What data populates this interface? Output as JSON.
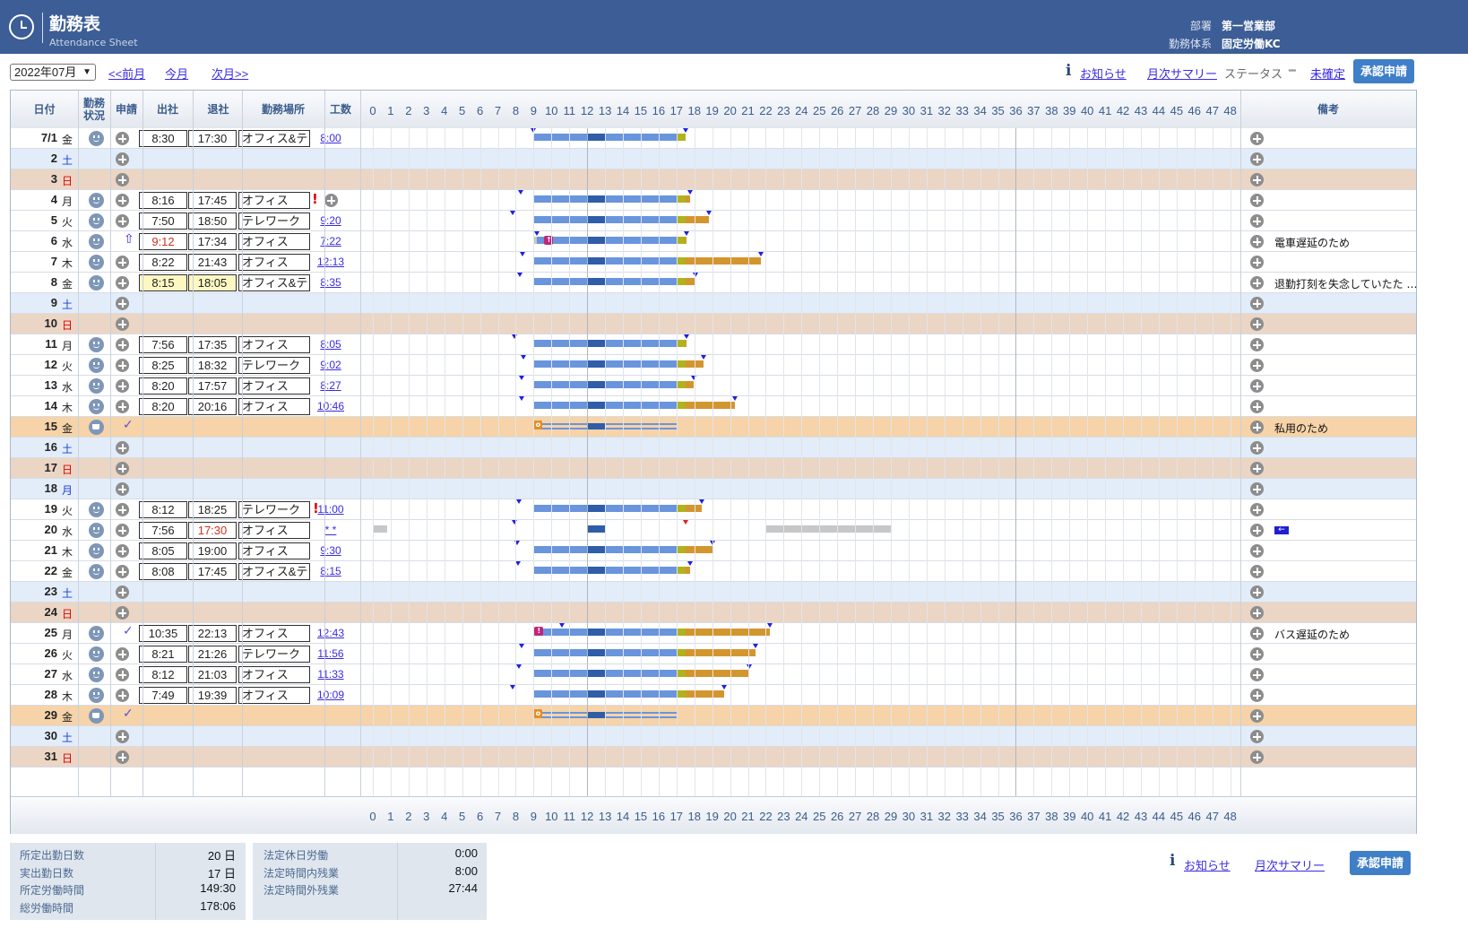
{
  "header": {
    "title": "勤務表",
    "subtitle": "Attendance Sheet",
    "dept_label": "部署",
    "dept_value": "第一営業部",
    "system_label": "勤務体系",
    "system_value": "固定労働KC"
  },
  "toolbar": {
    "month_select": "2022年07月",
    "prev_link": "<<前月",
    "this_link": "今月",
    "next_link": "次月>>",
    "notice": "お知らせ",
    "monthly_summary": "月次サマリー",
    "status_label": "ステータス",
    "status_dash": "━",
    "status_value": "未確定",
    "approve_button": "承認申請"
  },
  "columns": {
    "date": "日付",
    "status": "勤務状況",
    "request": "申請",
    "clock_in": "出社",
    "clock_out": "退社",
    "place": "勤務場所",
    "hours": "工数",
    "remarks": "備考"
  },
  "hours_axis": [
    "0",
    "1",
    "2",
    "3",
    "4",
    "5",
    "6",
    "7",
    "8",
    "9",
    "10",
    "11",
    "12",
    "13",
    "14",
    "15",
    "16",
    "17",
    "18",
    "19",
    "20",
    "21",
    "22",
    "23",
    "24",
    "25",
    "26",
    "27",
    "28",
    "29",
    "30",
    "31",
    "32",
    "33",
    "34",
    "35",
    "36",
    "37",
    "38",
    "39",
    "40",
    "41",
    "42",
    "43",
    "44",
    "45",
    "46",
    "47",
    "48"
  ],
  "rows": [
    {
      "day": "7/1",
      "dow": "金",
      "type": "wd",
      "face": "smile",
      "req": "plus",
      "in": "8:30",
      "out": "17:30",
      "place": "オフィス&テレ",
      "hours": "8:00",
      "note": "",
      "bars": [
        [
          9,
          0.5,
          12,
          "b1"
        ],
        [
          12,
          0,
          13,
          "b2"
        ],
        [
          13,
          0,
          17,
          "b1"
        ],
        [
          17,
          0,
          17,
          "b3"
        ]
      ],
      "tri": [
        9,
        17.5
      ]
    },
    {
      "day": "2",
      "dow": "土",
      "type": "sat",
      "face": "",
      "req": "plus"
    },
    {
      "day": "3",
      "dow": "日",
      "type": "sun",
      "face": "",
      "req": "plus"
    },
    {
      "day": "4",
      "dow": "月",
      "type": "wd",
      "face": "smile",
      "req": "plus",
      "in": "8:16",
      "out": "17:45",
      "place": "オフィス",
      "hours": "",
      "warn": true,
      "note": "",
      "tri": [
        8.27,
        17.75
      ]
    },
    {
      "day": "5",
      "dow": "火",
      "type": "wd",
      "face": "smile",
      "req": "plus",
      "in": "7:50",
      "out": "18:50",
      "place": "テレワーク",
      "hours": "9:20",
      "note": "",
      "tri": [
        7.83,
        18.83
      ]
    },
    {
      "day": "6",
      "dow": "水",
      "type": "wd",
      "face": "smile",
      "req": "up",
      "in": "9:12",
      "in_late": true,
      "out": "17:34",
      "place": "オフィス",
      "hours": "7:22",
      "note": "電車遅延のため",
      "tri": [
        9.2,
        17.57
      ]
    },
    {
      "day": "7",
      "dow": "木",
      "type": "wd",
      "face": "smile",
      "req": "plus",
      "in": "8:22",
      "out": "21:43",
      "place": "オフィス",
      "hours": "12:13",
      "note": "",
      "tri": [
        8.37,
        21.72
      ]
    },
    {
      "day": "8",
      "dow": "金",
      "type": "wd",
      "face": "smile",
      "req": "plus",
      "in": "8:15",
      "out": "18:05",
      "hl": true,
      "place": "オフィス&テレ",
      "hours": "8:35",
      "note": "退勤打刻を失念していたた …",
      "tri": [
        8.25,
        18.08
      ]
    },
    {
      "day": "9",
      "dow": "土",
      "type": "sat",
      "face": "",
      "req": "plus"
    },
    {
      "day": "10",
      "dow": "日",
      "type": "sun",
      "face": "",
      "req": "plus"
    },
    {
      "day": "11",
      "dow": "月",
      "type": "wd",
      "face": "smile",
      "req": "plus",
      "in": "7:56",
      "out": "17:35",
      "place": "オフィス",
      "hours": "8:05",
      "note": "",
      "tri": [
        7.93,
        17.58
      ]
    },
    {
      "day": "12",
      "dow": "火",
      "type": "wd",
      "face": "smile",
      "req": "plus",
      "in": "8:25",
      "out": "18:32",
      "place": "テレワーク",
      "hours": "9:02",
      "note": "",
      "tri": [
        8.42,
        18.53
      ]
    },
    {
      "day": "13",
      "dow": "水",
      "type": "wd",
      "face": "smile",
      "req": "plus",
      "in": "8:20",
      "out": "17:57",
      "place": "オフィス",
      "hours": "8:27",
      "note": "",
      "tri": [
        8.33,
        17.95
      ]
    },
    {
      "day": "14",
      "dow": "木",
      "type": "wd",
      "face": "smile",
      "req": "plus",
      "in": "8:20",
      "out": "20:16",
      "place": "オフィス",
      "hours": "10:46",
      "note": "",
      "tri": [
        8.33,
        20.27
      ]
    },
    {
      "day": "15",
      "dow": "金",
      "type": "leave",
      "face": "cup",
      "req": "check",
      "note": "私用のため",
      "leave": true
    },
    {
      "day": "16",
      "dow": "土",
      "type": "sat",
      "face": "",
      "req": "plus"
    },
    {
      "day": "17",
      "dow": "日",
      "type": "sun",
      "face": "",
      "req": "plus"
    },
    {
      "day": "18",
      "dow": "月",
      "type": "sat",
      "face": "",
      "req": "plus"
    },
    {
      "day": "19",
      "dow": "火",
      "type": "wd",
      "face": "smile",
      "req": "plus",
      "in": "8:12",
      "out": "18:25",
      "place": "テレワーク",
      "hours": "11:00",
      "warn": true,
      "note": "",
      "tri": [
        8.2,
        18.42
      ]
    },
    {
      "day": "20",
      "dow": "水",
      "type": "wd",
      "face": "smile",
      "req": "plus",
      "in": "7:56",
      "out": "17:30",
      "out_late": true,
      "place": "オフィス",
      "hours": "* *",
      "note": "",
      "arrow": true
    },
    {
      "day": "21",
      "dow": "木",
      "type": "wd",
      "face": "smile",
      "req": "plus",
      "in": "8:05",
      "out": "19:00",
      "place": "オフィス",
      "hours": "9:30",
      "note": "",
      "tri": [
        8.08,
        19.0
      ]
    },
    {
      "day": "22",
      "dow": "金",
      "type": "wd",
      "face": "smile",
      "req": "plus",
      "in": "8:08",
      "out": "17:45",
      "place": "オフィス&テレ",
      "hours": "8:15",
      "note": "",
      "tri": [
        8.13,
        17.75
      ]
    },
    {
      "day": "23",
      "dow": "土",
      "type": "sat",
      "face": "",
      "req": "plus"
    },
    {
      "day": "24",
      "dow": "日",
      "type": "sun",
      "face": "",
      "req": "plus"
    },
    {
      "day": "25",
      "dow": "月",
      "type": "wd",
      "face": "smile",
      "req": "check",
      "in": "10:35",
      "out": "22:13",
      "place": "オフィス",
      "hours": "12:43",
      "note": "バス遅延のため",
      "tri": [
        10.58,
        22.22
      ]
    },
    {
      "day": "26",
      "dow": "火",
      "type": "wd",
      "face": "smile",
      "req": "plus",
      "in": "8:21",
      "out": "21:26",
      "place": "テレワーク",
      "hours": "11:56",
      "note": "",
      "tri": [
        8.35,
        21.43
      ]
    },
    {
      "day": "27",
      "dow": "水",
      "type": "wd",
      "face": "smile",
      "req": "plus",
      "in": "8:12",
      "out": "21:03",
      "place": "オフィス",
      "hours": "11:33",
      "note": "",
      "tri": [
        8.2,
        21.05
      ]
    },
    {
      "day": "28",
      "dow": "木",
      "type": "wd",
      "face": "smile",
      "req": "plus",
      "in": "7:49",
      "out": "19:39",
      "place": "オフィス",
      "hours": "10:09",
      "note": "",
      "tri": [
        7.82,
        19.65
      ]
    },
    {
      "day": "29",
      "dow": "金",
      "type": "leave",
      "face": "cup",
      "req": "check",
      "note": "",
      "leave": true
    },
    {
      "day": "30",
      "dow": "土",
      "type": "sat",
      "face": "",
      "req": "plus"
    },
    {
      "day": "31",
      "dow": "日",
      "type": "sun",
      "face": "",
      "req": "plus"
    }
  ],
  "summary_left": [
    {
      "label": "所定出勤日数",
      "value": "20 日"
    },
    {
      "label": "実出勤日数",
      "value": "17 日"
    },
    {
      "label": "所定労働時間",
      "value": "149:30"
    },
    {
      "label": "総労働時間",
      "value": "178:06"
    }
  ],
  "summary_right": [
    {
      "label": "法定休日労働",
      "value": "0:00"
    },
    {
      "label": "法定時間内残業",
      "value": "8:00"
    },
    {
      "label": "法定時間外残業",
      "value": "27:44"
    }
  ],
  "bottom": {
    "notice": "お知らせ",
    "monthly_summary": "月次サマリー",
    "approve_button": "承認申請"
  },
  "colors": {
    "header_bg": "#3c5d95",
    "work_bar": "#6995dd",
    "break_bar": "#2f5da8",
    "overtime_bar": "#d3962e",
    "pre_overtime_bar": "#b1b21c",
    "saturday_row": "#e2edf9",
    "sunday_row": "#ebd5c4",
    "leave_row": "#f6d3a8"
  },
  "icons": {
    "clock": "clock-icon",
    "info": "info-icon",
    "status_face": "smile-face-icon",
    "leave_face": "coffee-cup-icon",
    "add": "plus-circle-icon",
    "approved": "check-icon",
    "request_up": "up-arrow-icon",
    "warning": "exclamation-icon"
  }
}
